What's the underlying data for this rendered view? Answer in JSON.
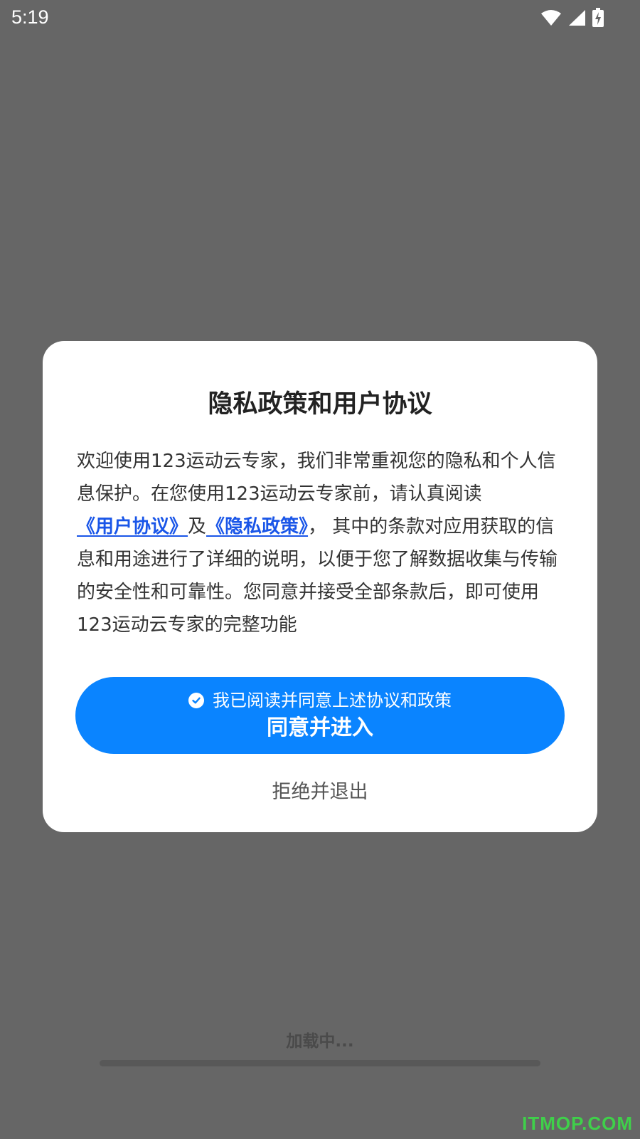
{
  "status_bar": {
    "time": "5:19",
    "icons": [
      "wifi-icon",
      "cellular-signal-icon",
      "battery-charging-icon"
    ]
  },
  "dialog": {
    "title": "隐私政策和用户协议",
    "body": {
      "intro": "欢迎使用123运动云专家，我们非常重视您的隐私和个人信息保护。在您使用123运动云专家前，请认真阅读",
      "link_user_agreement": "《用户协议》",
      "connector": "及",
      "link_privacy_policy": "《隐私政策》",
      "rest": "， 其中的条款对应用获取的信息和用途进行了详细的说明，以便于您了解数据收集与传输的安全性和可靠性。您同意并接受全部条款后，即可使用123运动云专家的完整功能"
    },
    "agree_checkbox_label": "我已阅读并同意上述协议和政策",
    "agree_checked": true,
    "agree_button_label": "同意并进入",
    "reject_label": "拒绝并退出"
  },
  "loading": {
    "text": "加载中...",
    "progress": 0
  },
  "watermark": "ITMOP.COM",
  "colors": {
    "overlay": "#666666",
    "primary_button": "#0a84ff",
    "link": "#1a56e8",
    "watermark": "#3fd04a"
  }
}
